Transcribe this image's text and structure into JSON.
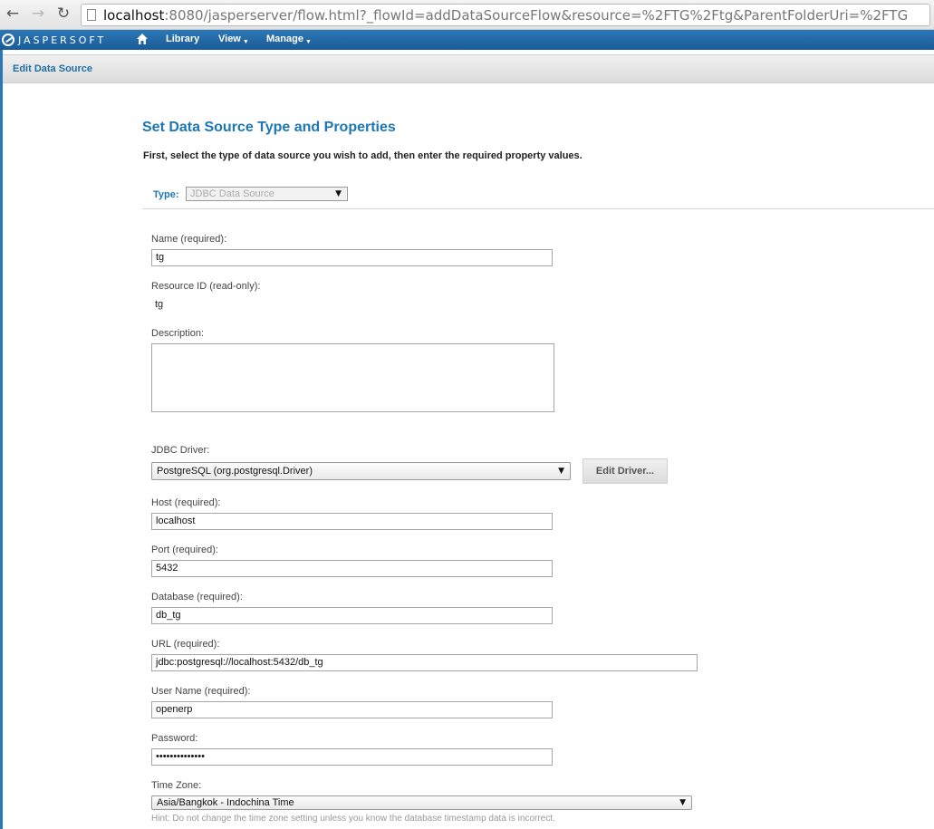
{
  "browser": {
    "url_host": "localhost",
    "url_rest": ":8080/jasperserver/flow.html?_flowId=addDataSourceFlow&resource=%2FTG%2Ftg&ParentFolderUri=%2FTG"
  },
  "app": {
    "logo_text": "JASPERSOFT",
    "menu": {
      "library": "Library",
      "view": "View",
      "manage": "Manage"
    }
  },
  "page": {
    "header_title": "Edit Data Source",
    "section_title": "Set Data Source Type and Properties",
    "intro": "First, select the type of data source you wish to add, then enter the required property values."
  },
  "form": {
    "type_label": "Type:",
    "type_value": "JDBC Data Source",
    "name_label": "Name (required):",
    "name_value": "tg",
    "resource_id_label": "Resource ID (read-only):",
    "resource_id_value": "tg",
    "description_label": "Description:",
    "jdbc_driver_label": "JDBC Driver:",
    "jdbc_driver_value": "PostgreSQL (org.postgresql.Driver)",
    "edit_driver_label": "Edit Driver...",
    "host_label": "Host (required):",
    "host_value": "localhost",
    "port_label": "Port (required):",
    "port_value": "5432",
    "database_label": "Database (required):",
    "database_value": "db_tg",
    "url_label": "URL (required):",
    "url_value": "jdbc:postgresql://localhost:5432/db_tg",
    "username_label": "User Name (required):",
    "username_value": "openerp",
    "password_label": "Password:",
    "password_value": "••••••••••••••",
    "timezone_label": "Time Zone:",
    "timezone_value": "Asia/Bangkok - Indochina Time",
    "timezone_hint": "Hint: Do not change the time zone setting unless you know the database timestamp data is incorrect."
  },
  "colors": {
    "app_bar": "#2b78b6",
    "title_blue": "#1c77b3"
  }
}
